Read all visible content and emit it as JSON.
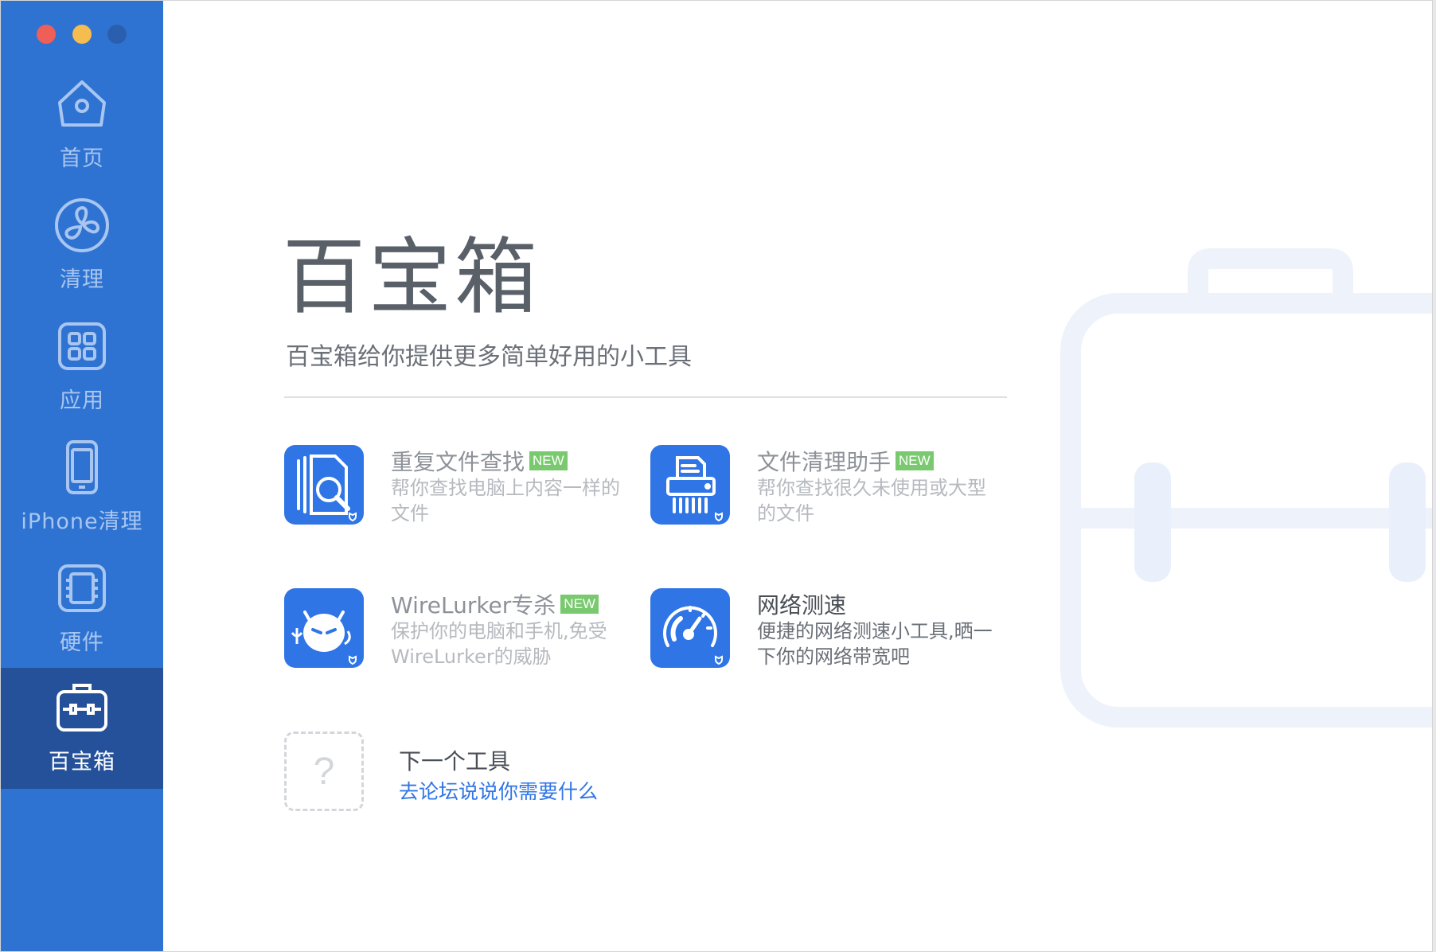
{
  "sidebar": {
    "items": [
      {
        "label": "首页",
        "icon": "home-icon"
      },
      {
        "label": "清理",
        "icon": "fan-icon"
      },
      {
        "label": "应用",
        "icon": "apps-grid-icon"
      },
      {
        "label": "iPhone清理",
        "icon": "iphone-icon"
      },
      {
        "label": "硬件",
        "icon": "chip-icon"
      },
      {
        "label": "百宝箱",
        "icon": "toolbox-icon",
        "active": true
      }
    ]
  },
  "main": {
    "title": "百宝箱",
    "subtitle": "百宝箱给你提供更多简单好用的小工具",
    "tools": [
      {
        "title": "重复文件查找",
        "badge": "NEW",
        "desc": "帮你查找电脑上内容一样的文件",
        "icon": "duplicate-search-icon"
      },
      {
        "title": "文件清理助手",
        "badge": "NEW",
        "desc": "帮你查找很久未使用或大型的文件",
        "icon": "shredder-icon"
      },
      {
        "title": "WireLurker专杀",
        "badge": "NEW",
        "desc": "保护你的电脑和手机,免受WireLurker的威胁",
        "icon": "devil-icon"
      },
      {
        "title": "网络测速",
        "desc": "便捷的网络测速小工具,晒一下你的网络带宽吧",
        "icon": "speedometer-icon"
      }
    ],
    "next_tool": {
      "placeholder_symbol": "?",
      "title": "下一个工具",
      "link": "去论坛说说你需要什么"
    }
  },
  "colors": {
    "sidebar": "#2f73d2",
    "sidebar_active": "#24519a",
    "accent": "#2f75e6",
    "badge": "#79c96f"
  }
}
